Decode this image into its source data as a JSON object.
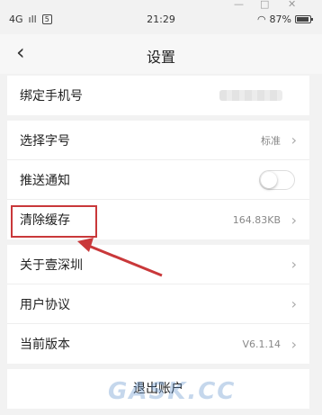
{
  "window": {
    "minimize": "—",
    "maximize": "□",
    "close": "✕"
  },
  "status_bar": {
    "network": "4G",
    "signal": "ıll",
    "sim": "5",
    "time": "21:29",
    "wifi": "◠",
    "battery_text": "87%"
  },
  "nav": {
    "back_icon": "back-chevron",
    "title": "设置"
  },
  "account": {
    "bind_phone_label": "绑定手机号"
  },
  "settings": {
    "font_size_label": "选择字号",
    "font_size_value": "标准",
    "push_label": "推送通知",
    "push_enabled": false,
    "cache_label": "清除缓存",
    "cache_value": "164.83KB"
  },
  "about": {
    "about_label": "关于壹深圳",
    "agreement_label": "用户协议",
    "version_label": "当前版本",
    "version_value": "V6.1.14"
  },
  "logout_label": "退出账户",
  "watermark": "GASK.CC",
  "colors": {
    "highlight": "#c9383a",
    "background": "#f2f2f2"
  }
}
